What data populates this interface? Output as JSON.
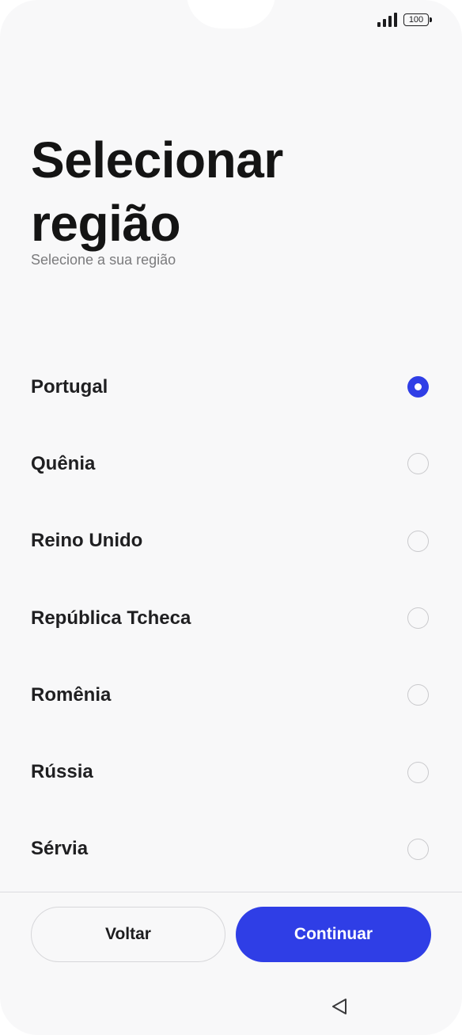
{
  "status_bar": {
    "battery_level": "100",
    "signal_icon": "signal-icon",
    "battery_icon": "battery-icon"
  },
  "header": {
    "title_line1": "Selecionar",
    "title_line2": "região",
    "subtitle": "Selecione a sua região"
  },
  "regions": [
    {
      "label": "Portugal",
      "selected": true
    },
    {
      "label": "Quênia",
      "selected": false
    },
    {
      "label": "Reino Unido",
      "selected": false
    },
    {
      "label": "República Tcheca",
      "selected": false
    },
    {
      "label": "Romênia",
      "selected": false
    },
    {
      "label": "Rússia",
      "selected": false
    },
    {
      "label": "Sérvia",
      "selected": false
    }
  ],
  "footer": {
    "back_label": "Voltar",
    "continue_label": "Continuar"
  },
  "colors": {
    "accent": "#2f3ee6",
    "background": "#f8f8f9",
    "text": "#1f1f21",
    "muted": "#7b7b7d"
  },
  "nav": {
    "back_icon": "triangle-back-icon"
  }
}
